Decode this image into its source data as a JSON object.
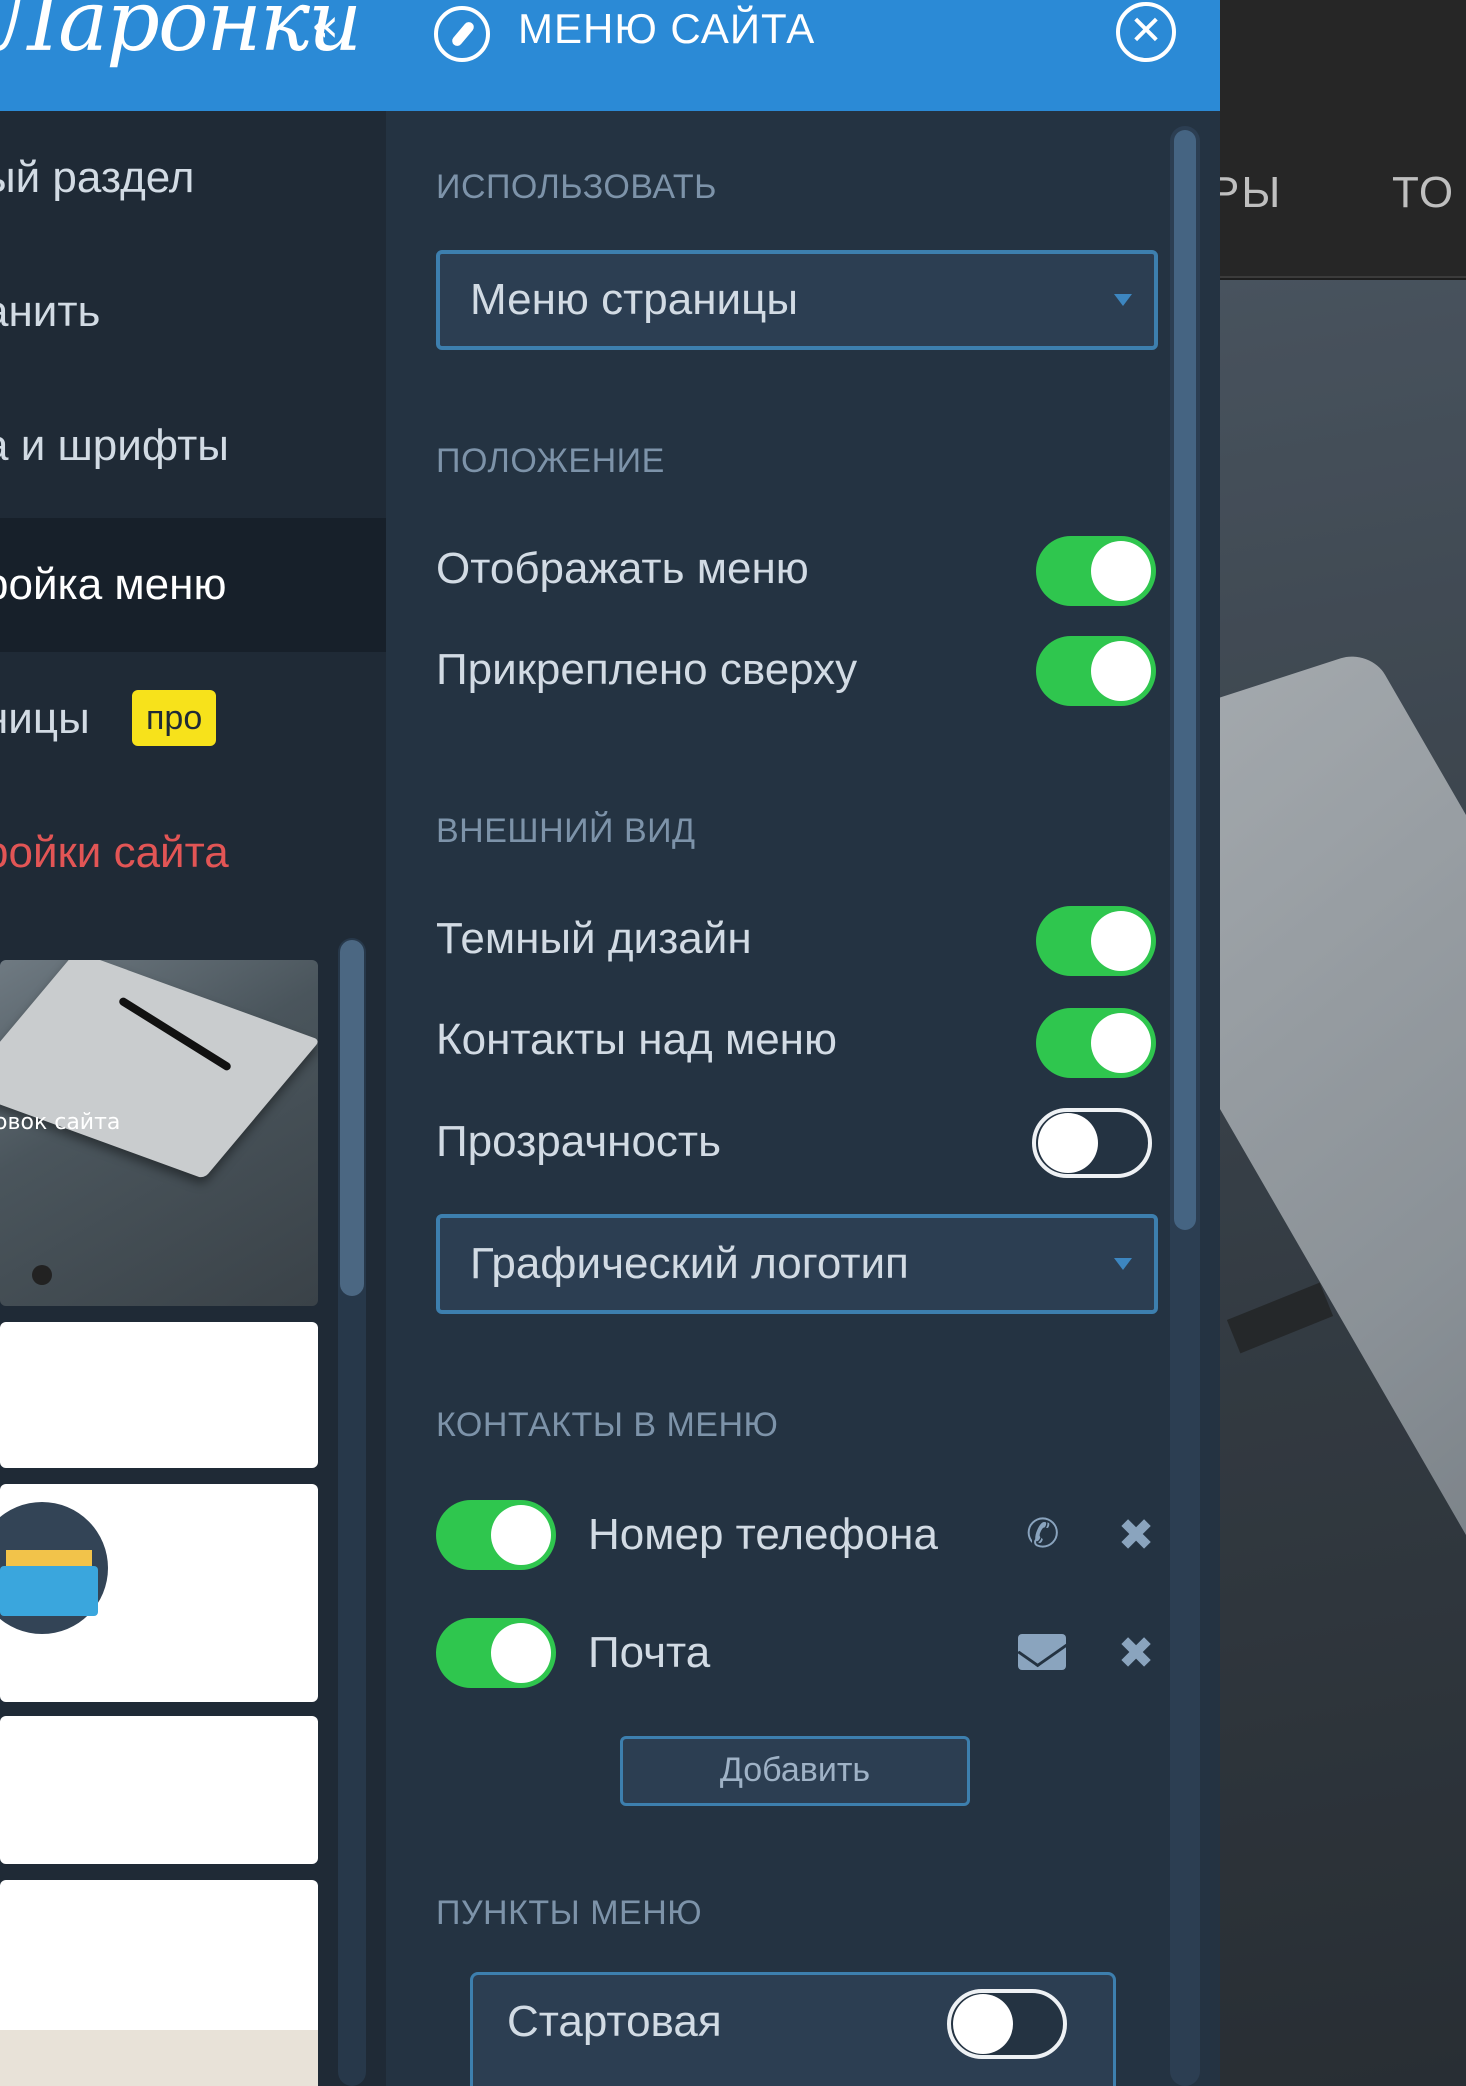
{
  "sidebar": {
    "logo_text": "Ларонки",
    "collapse_icon": "«",
    "items": [
      {
        "label": "ый раздел"
      },
      {
        "label": "анить"
      },
      {
        "label": "а и шрифты"
      },
      {
        "label": "ройка меню"
      },
      {
        "label": "ницы"
      },
      {
        "label": "ройки сайта"
      }
    ],
    "pro_badge": "про",
    "thumb_title": "ловок сайта"
  },
  "menu_panel": {
    "title": "МЕНЮ САЙТА",
    "close_icon": "✕",
    "sections": {
      "use": "ИСПОЛЬЗОВАТЬ",
      "position": "ПОЛОЖЕНИЕ",
      "appearance": "ВНЕШНИЙ ВИД",
      "contacts": "КОНТАКТЫ В МЕНЮ",
      "menu_items": "ПУНКТЫ МЕНЮ"
    },
    "use_select": {
      "value": "Меню страницы"
    },
    "toggles": {
      "show_menu": {
        "label": "Отображать меню",
        "on": true
      },
      "sticky_top": {
        "label": "Прикреплено сверху",
        "on": true
      },
      "dark_design": {
        "label": "Темный дизайн",
        "on": true
      },
      "contacts_above": {
        "label": "Контакты над меню",
        "on": true
      },
      "transparency": {
        "label": "Прозрачность",
        "on": false
      }
    },
    "logo_select": {
      "value": "Графический логотип"
    },
    "contacts": [
      {
        "label": "Номер телефона",
        "icon": "phone-icon",
        "on": true
      },
      {
        "label": "Почта",
        "icon": "mail-icon",
        "on": true
      }
    ],
    "remove_icon": "✖",
    "add_label": "Добавить",
    "items": [
      {
        "label": "Стартовая",
        "on": false
      }
    ]
  },
  "preview": {
    "nav": [
      "РЫ",
      "ТО"
    ]
  },
  "colors": {
    "accent_blue": "#2b8ad6",
    "panel_bg": "#243342",
    "toggle_on": "#2fc64e",
    "pro_badge": "#f7e21b",
    "danger": "#e25555"
  }
}
